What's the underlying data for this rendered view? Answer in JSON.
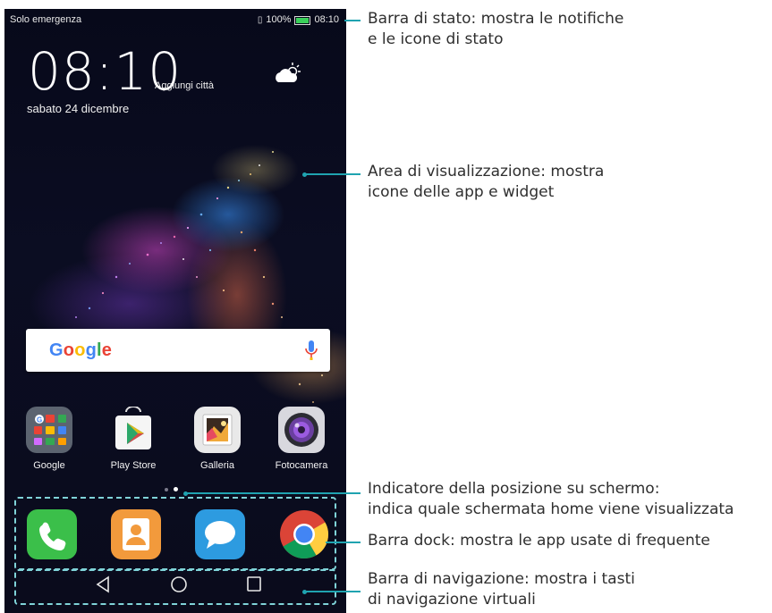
{
  "status_bar": {
    "carrier": "Solo emergenza",
    "battery_percent": "100%",
    "time": "08:10",
    "icons": [
      "sim-icon",
      "battery-icon"
    ]
  },
  "lockscreen_widget": {
    "clock": "08:10",
    "add_city": "Aggiungi città",
    "date": "sabato 24 dicembre",
    "weather_icon": "partly-sunny-icon"
  },
  "search_bar": {
    "logo_text": "Google",
    "mic_icon": "mic-icon"
  },
  "apps": [
    {
      "label": "Google",
      "icon": "google-folder-icon"
    },
    {
      "label": "Play Store",
      "icon": "play-store-icon"
    },
    {
      "label": "Galleria",
      "icon": "gallery-icon"
    },
    {
      "label": "Fotocamera",
      "icon": "camera-icon"
    }
  ],
  "page_indicator": {
    "pages": 2,
    "current": 2
  },
  "dock": [
    {
      "icon": "phone-icon",
      "color": "#3bbf4a"
    },
    {
      "icon": "contacts-icon",
      "color": "#f29a3c"
    },
    {
      "icon": "messages-icon",
      "color": "#2d9be0"
    },
    {
      "icon": "chrome-icon",
      "color": "#4285f4"
    }
  ],
  "navigation": [
    "back-icon",
    "home-icon",
    "recents-icon"
  ],
  "callouts": {
    "status_bar": [
      "Barra di stato: mostra le notifiche",
      "e le icone di stato"
    ],
    "display_area": [
      "Area di visualizzazione: mostra",
      "icone delle app e widget"
    ],
    "position_indicator": [
      "Indicatore della posizione su schermo:",
      "indica quale schermata home viene visualizzata"
    ],
    "dock_bar": [
      "Barra dock: mostra le app usate di frequente"
    ],
    "nav_bar": [
      "Barra di navigazione: mostra i tasti",
      "di navigazione virtuali"
    ]
  },
  "colors": {
    "accent": "#1fa3b0",
    "dashed_outline": "#7fd3d8"
  }
}
